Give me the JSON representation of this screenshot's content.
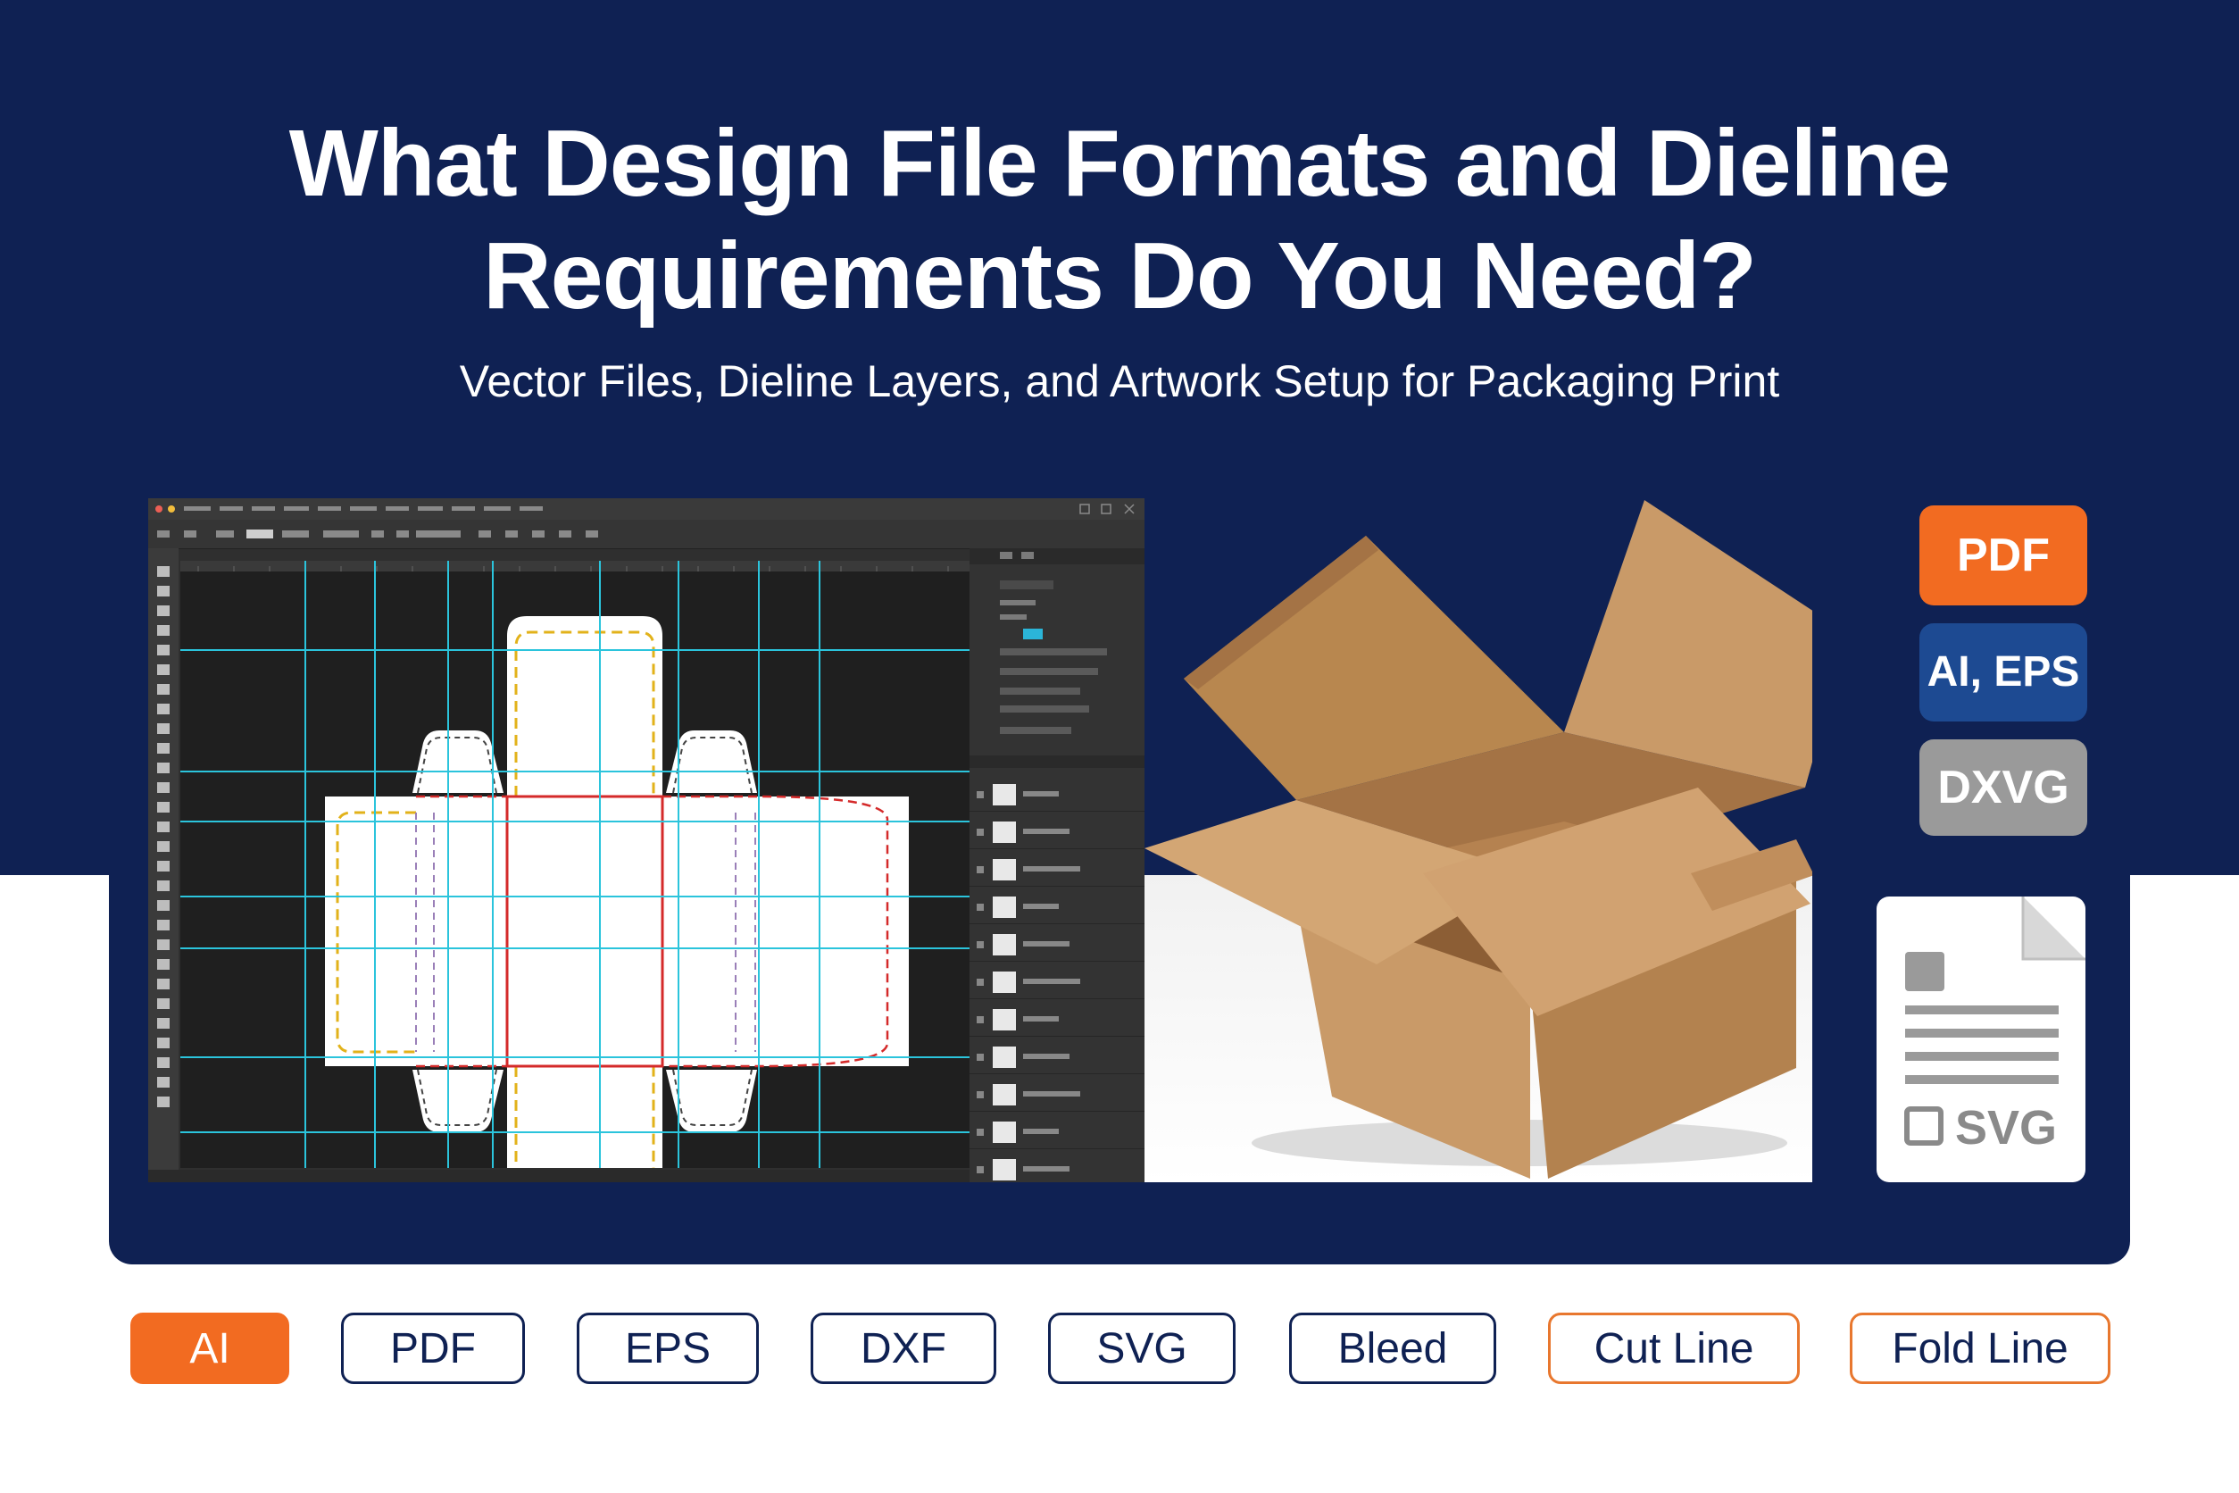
{
  "header": {
    "title_line1": "What Design File Formats and Dieline",
    "title_line2": "Requirements Do You Need?",
    "subtitle": "Vector Files, Dieline Layers, and Artwork Setup for Packaging Print"
  },
  "format_badges": [
    {
      "label": "PDF",
      "color": "#f26b21"
    },
    {
      "label": "AI, EPS",
      "color": "#1d4a92"
    },
    {
      "label": "DXVG",
      "color": "#9a9a9a"
    }
  ],
  "document_card": {
    "label": "SVG",
    "icon": "document-icon"
  },
  "tags": [
    {
      "label": "AI",
      "style": "orange-fill"
    },
    {
      "label": "PDF",
      "style": "outline"
    },
    {
      "label": "EPS",
      "style": "outline"
    },
    {
      "label": "DXF",
      "style": "outline"
    },
    {
      "label": "SVG",
      "style": "outline"
    },
    {
      "label": "Bleed",
      "style": "outline"
    },
    {
      "label": "Cut Line",
      "style": "orange-line"
    },
    {
      "label": "Fold Line",
      "style": "orange-line"
    }
  ],
  "colors": {
    "navy": "#0f2153",
    "orange": "#f26b21",
    "guide_cyan": "#2bc4dc",
    "cut_red": "#d42a2a",
    "bleed_yellow": "#e2b21a",
    "cardboard": "#c9996a"
  }
}
